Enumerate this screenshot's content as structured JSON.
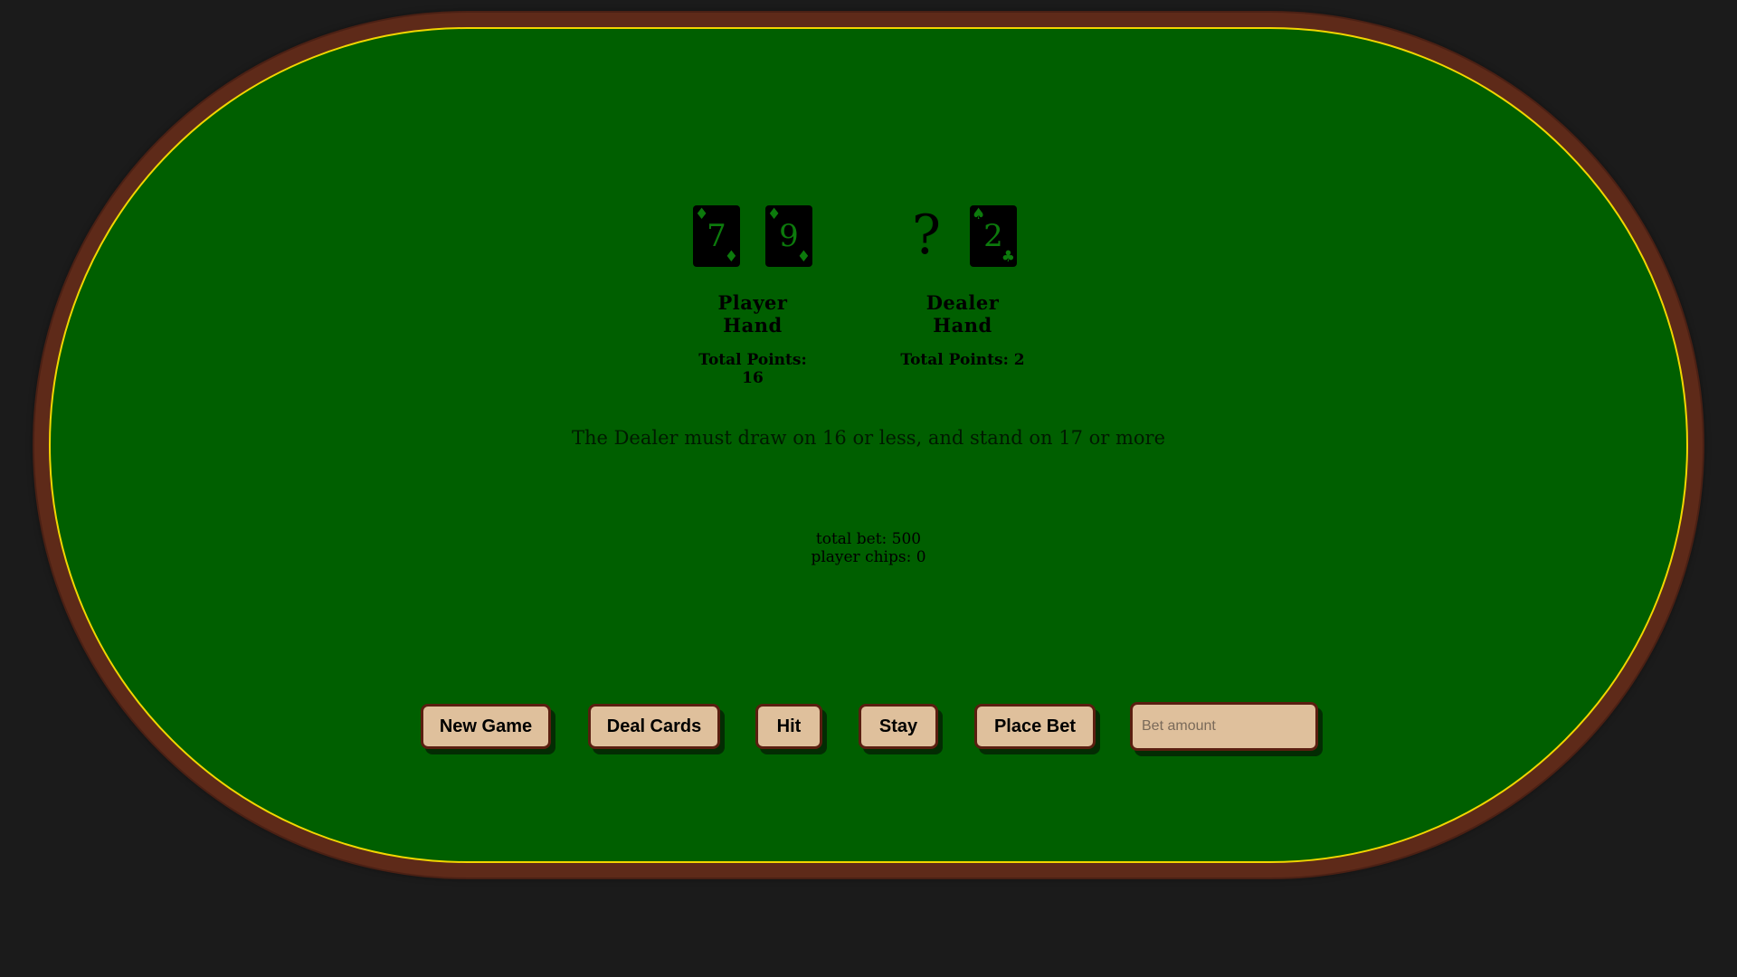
{
  "player": {
    "cards": [
      {
        "rank": "7",
        "suit": "diamond-icon",
        "pip": "♦"
      },
      {
        "rank": "9",
        "suit": "diamond-icon",
        "pip": "♦"
      }
    ],
    "title": "Player Hand",
    "points": "Total Points: 16"
  },
  "dealer": {
    "hidden": "?",
    "cards": [
      {
        "rank": "2",
        "suit": "spade-icon",
        "pip_top": "♠",
        "pip_bottom": "♣"
      }
    ],
    "title": "Dealer Hand",
    "points": "Total Points: 2"
  },
  "rule_text": "The Dealer must draw on 16 or less, and stand on 17 or more",
  "stats": {
    "total_bet": "total bet: 500",
    "player_chips": "player chips: 0"
  },
  "controls": {
    "new_game": "New Game",
    "deal_cards": "Deal Cards",
    "hit": "Hit",
    "stay": "Stay",
    "place_bet": "Place Bet",
    "bet_placeholder": "Bet amount"
  },
  "colors": {
    "felt": "#005f00",
    "rail": "#5e2a19",
    "trim": "#f2d600",
    "button": "#dfc09c",
    "card_text": "#0c7a0c"
  }
}
